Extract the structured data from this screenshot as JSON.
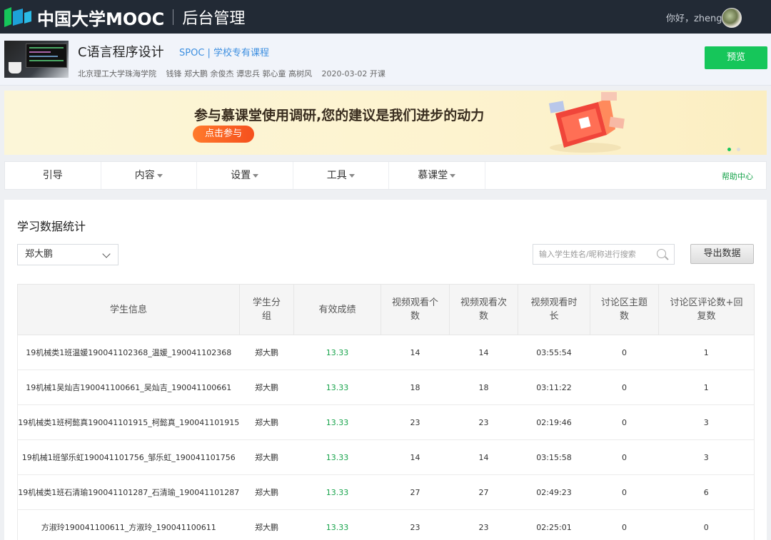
{
  "topbar": {
    "brand": "中国大学MOOC",
    "section": "后台管理",
    "greeting": "你好，zhengdp"
  },
  "course": {
    "title": "C语言程序设计",
    "tag": "SPOC | 学校专有课程",
    "school": "北京理工大学珠海学院",
    "teachers": "钱锋 郑大鹏 余俊杰 谭忠兵 郭心童 高树风",
    "start": "2020-03-02 开课",
    "preview_label": "预览"
  },
  "banner": {
    "text": "参与慕课堂使用调研,您的建议是我们进步的动力",
    "button": "点击参与"
  },
  "nav": {
    "items": [
      "引导",
      "内容",
      "设置",
      "工具",
      "慕课堂"
    ],
    "help": "帮助中心"
  },
  "panel": {
    "title": "学习数据统计",
    "group_select": "郑大鹏",
    "search_placeholder": "输入学生姓名/昵称进行搜索",
    "export_label": "导出数据"
  },
  "table": {
    "headers": [
      "学生信息",
      "学生分组",
      "有效成绩",
      "视频观看个数",
      "视频观看次数",
      "视频观看时长",
      "讨论区主题数",
      "讨论区评论数+回复数"
    ],
    "rows": [
      [
        "19机械类1班温媛190041102368_温媛_190041102368",
        "郑大鹏",
        "13.33",
        "14",
        "14",
        "03:55:54",
        "0",
        "1"
      ],
      [
        "19机械1吴灿吉190041100661_吴灿吉_190041100661",
        "郑大鹏",
        "13.33",
        "18",
        "18",
        "03:11:22",
        "0",
        "1"
      ],
      [
        "19机械类1班柯懿真190041101915_柯懿真_190041101915",
        "郑大鹏",
        "13.33",
        "23",
        "23",
        "02:19:46",
        "0",
        "3"
      ],
      [
        "19机械1班邹乐虹190041101756_邹乐虹_190041101756",
        "郑大鹏",
        "13.33",
        "14",
        "14",
        "03:15:58",
        "0",
        "3"
      ],
      [
        "19机械类1班石清瑜190041101287_石清瑜_190041101287",
        "郑大鹏",
        "13.33",
        "27",
        "27",
        "02:49:23",
        "0",
        "6"
      ],
      [
        "方淑玲190041100611_方淑玲_190041100611",
        "郑大鹏",
        "13.33",
        "23",
        "23",
        "02:25:01",
        "0",
        "0"
      ]
    ]
  },
  "colors": {
    "topbar_bg": "#222a35",
    "accent_green": "#16c65a",
    "tag_blue": "#3d8fe0",
    "banner_button": "#f5501e"
  }
}
